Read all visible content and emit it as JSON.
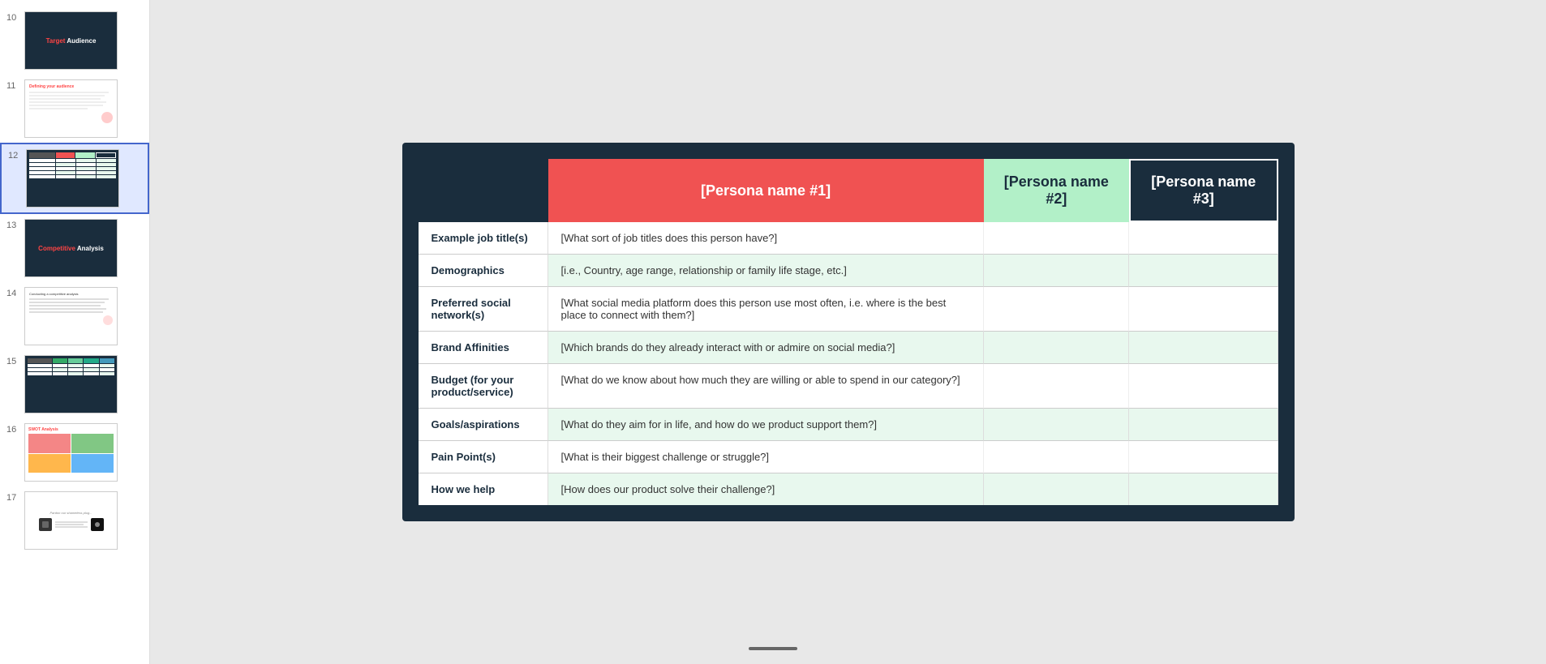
{
  "sidebar": {
    "slides": [
      {
        "number": "10",
        "type": "target-audience",
        "label": "Target Audience slide",
        "active": false
      },
      {
        "number": "11",
        "type": "defining-audience",
        "label": "Defining your audience slide",
        "active": false
      },
      {
        "number": "12",
        "type": "persona-table",
        "label": "Persona comparison table slide",
        "active": true
      },
      {
        "number": "13",
        "type": "competitive-analysis",
        "label": "Competitive Analysis slide",
        "active": false
      },
      {
        "number": "14",
        "type": "conducting-competitive",
        "label": "Conducting a competitive analysis slide",
        "active": false
      },
      {
        "number": "15",
        "type": "persona-table-2",
        "label": "Persona table 2 slide",
        "active": false
      },
      {
        "number": "16",
        "type": "swot",
        "label": "SWOT Analysis slide",
        "active": false
      },
      {
        "number": "17",
        "type": "pardon",
        "label": "Pardon our shameless plug slide",
        "active": false
      }
    ]
  },
  "main": {
    "table": {
      "persona1_label": "[Persona name #1]",
      "persona2_label": "[Persona name #2]",
      "persona3_label": "[Persona name #3]",
      "rows": [
        {
          "label": "Example job title(s)",
          "cell1": "[What sort of job titles does this person have?]",
          "cell2": "",
          "cell3": ""
        },
        {
          "label": "Demographics",
          "cell1": "[i.e., Country, age range, relationship or family life stage, etc.]",
          "cell2": "",
          "cell3": ""
        },
        {
          "label": "Preferred social network(s)",
          "cell1": "[What social media platform does this person use most often, i.e. where is the best place to connect with them?]",
          "cell2": "",
          "cell3": ""
        },
        {
          "label": "Brand Affinities",
          "cell1": "[Which brands do they already interact with or admire on  social media?]",
          "cell2": "",
          "cell3": ""
        },
        {
          "label": "Budget (for your product/service)",
          "cell1": "[What do we know about how much they are willing or able to spend in our category?]",
          "cell2": "",
          "cell3": ""
        },
        {
          "label": "Goals/aspirations",
          "cell1": "[What do they aim for in life, and how do we product support them?]",
          "cell2": "",
          "cell3": ""
        },
        {
          "label": "Pain Point(s)",
          "cell1": "[What is their biggest challenge or struggle?]",
          "cell2": "",
          "cell3": ""
        },
        {
          "label": "How we help",
          "cell1": "[How does our product solve their challenge?]",
          "cell2": "",
          "cell3": ""
        }
      ]
    }
  },
  "colors": {
    "dark_bg": "#1a2d3d",
    "persona1_bg": "#f05252",
    "persona2_bg": "#b2f0c8",
    "cell_green": "#e8f8ee",
    "cell_white": "#ffffff",
    "red_accent": "#ff4444"
  }
}
